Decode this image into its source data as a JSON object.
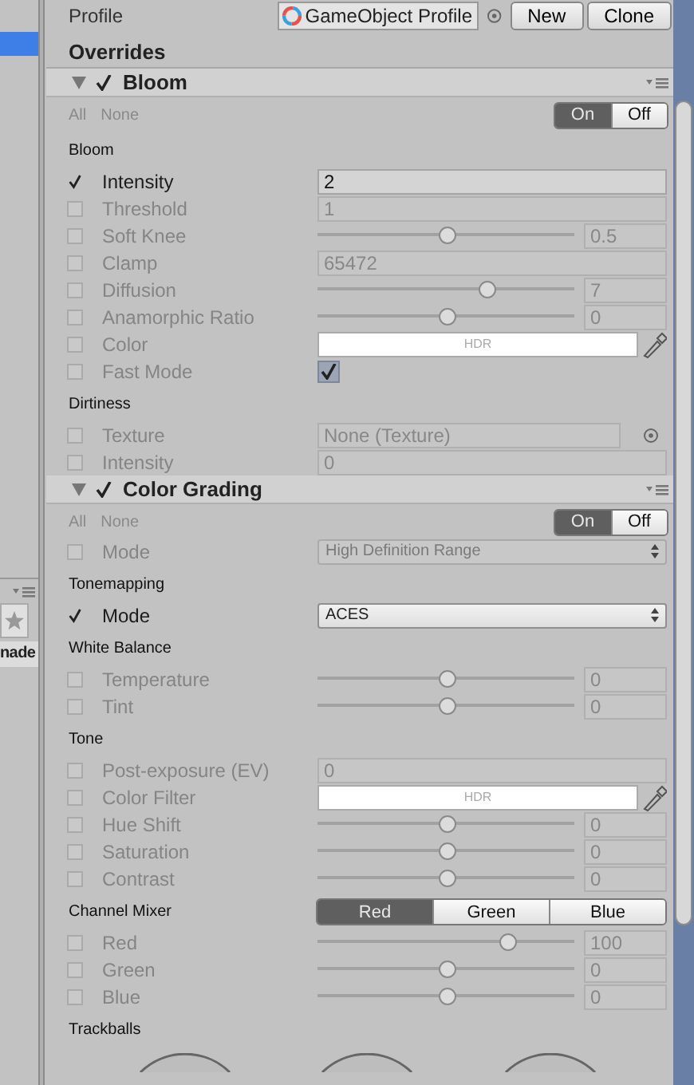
{
  "hierarchy": {
    "rows": [
      {
        "selected": true
      }
    ]
  },
  "project": {
    "label": "nade"
  },
  "profile": {
    "label": "Profile",
    "value": "GameObject Profile",
    "buttons": [
      "New",
      "Clone"
    ]
  },
  "overrides_title": "Overrides",
  "effects": [
    {
      "title": "Bloom",
      "expanded": true,
      "enabled": true,
      "all": "All",
      "none": "None",
      "toggle": [
        {
          "label": "On",
          "selected": true
        },
        {
          "label": "Off",
          "selected": false
        }
      ],
      "groups": [
        {
          "title": "Bloom",
          "rows": [
            {
              "kind": "field",
              "label": "Intensity",
              "overridden": true,
              "value": "2"
            },
            {
              "kind": "field",
              "label": "Threshold",
              "overridden": false,
              "value": "1"
            },
            {
              "kind": "slider",
              "label": "Soft Knee",
              "overridden": false,
              "level": 0.5,
              "value": "0.5"
            },
            {
              "kind": "field",
              "label": "Clamp",
              "overridden": false,
              "value": "65472"
            },
            {
              "kind": "slider",
              "label": "Diffusion",
              "overridden": false,
              "level": 0.66,
              "value": "7"
            },
            {
              "kind": "slider",
              "label": "Anamorphic Ratio",
              "overridden": false,
              "level": 0.5,
              "value": "0"
            },
            {
              "kind": "color",
              "label": "Color",
              "overridden": false,
              "value": "HDR"
            },
            {
              "kind": "checkbox",
              "label": "Fast Mode",
              "overridden": false,
              "checked": true
            }
          ]
        },
        {
          "title": "Dirtiness",
          "rows": [
            {
              "kind": "object",
              "label": "Texture",
              "overridden": false,
              "value": "None (Texture)"
            },
            {
              "kind": "field",
              "label": "Intensity",
              "overridden": false,
              "value": "0"
            }
          ]
        }
      ]
    },
    {
      "title": "Color Grading",
      "expanded": true,
      "enabled": true,
      "all": "All",
      "none": "None",
      "toggle": [
        {
          "label": "On",
          "selected": true
        },
        {
          "label": "Off",
          "selected": false
        }
      ],
      "groups": [
        {
          "rows": [
            {
              "kind": "dropdown",
              "label": "Mode",
              "overridden": false,
              "value": "High Definition Range"
            }
          ]
        },
        {
          "title": "Tonemapping",
          "rows": [
            {
              "kind": "dropdown",
              "label": "Mode",
              "overridden": true,
              "value": "ACES"
            }
          ]
        },
        {
          "title": "White Balance",
          "rows": [
            {
              "kind": "slider",
              "label": "Temperature",
              "overridden": false,
              "level": 0.5,
              "value": "0"
            },
            {
              "kind": "slider",
              "label": "Tint",
              "overridden": false,
              "level": 0.5,
              "value": "0"
            }
          ]
        },
        {
          "title": "Tone",
          "rows": [
            {
              "kind": "field",
              "label": "Post-exposure (EV)",
              "overridden": false,
              "value": "0"
            },
            {
              "kind": "color",
              "label": "Color Filter",
              "overridden": false,
              "value": "HDR"
            },
            {
              "kind": "slider",
              "label": "Hue Shift",
              "overridden": false,
              "level": 0.5,
              "value": "0"
            },
            {
              "kind": "slider",
              "label": "Saturation",
              "overridden": false,
              "level": 0.5,
              "value": "0"
            },
            {
              "kind": "slider",
              "label": "Contrast",
              "overridden": false,
              "level": 0.5,
              "value": "0"
            }
          ]
        },
        {
          "title": "Channel Mixer",
          "tabs": [
            {
              "label": "Red",
              "selected": true
            },
            {
              "label": "Green",
              "selected": false
            },
            {
              "label": "Blue",
              "selected": false
            }
          ],
          "rows": [
            {
              "kind": "slider",
              "label": "Red",
              "overridden": false,
              "level": 0.74,
              "value": "100"
            },
            {
              "kind": "slider",
              "label": "Green",
              "overridden": false,
              "level": 0.5,
              "value": "0"
            },
            {
              "kind": "slider",
              "label": "Blue",
              "overridden": false,
              "level": 0.5,
              "value": "0"
            }
          ]
        },
        {
          "title": "Trackballs",
          "rows": [
            {
              "kind": "trackball"
            },
            {
              "kind": "trackball"
            },
            {
              "kind": "trackball"
            }
          ]
        }
      ]
    }
  ]
}
